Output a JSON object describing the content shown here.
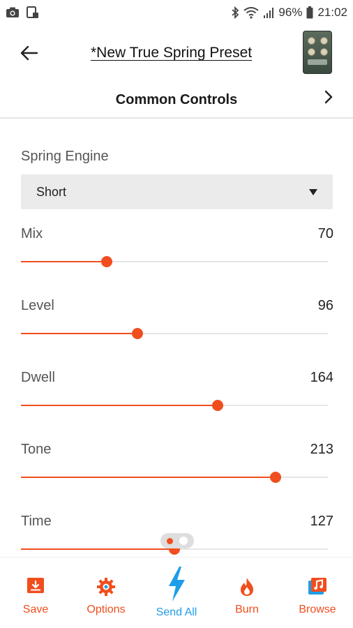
{
  "status_bar": {
    "battery": "96%",
    "time": "21:02",
    "icons": [
      "camera-icon",
      "image-sim-icon",
      "bluetooth-icon",
      "wifi-icon",
      "signal-icon",
      "battery-icon"
    ]
  },
  "header": {
    "preset_title": "*New True Spring Preset",
    "back_icon": "arrow-left-icon",
    "pedal_image": "true-spring-pedal-thumbnail"
  },
  "section": {
    "title": "Common Controls",
    "chevron_icon": "chevron-right-icon"
  },
  "spring_engine": {
    "label": "Spring Engine",
    "selected": "Short"
  },
  "parameters": [
    {
      "label": "Mix",
      "value": "70",
      "fraction": 0.28
    },
    {
      "label": "Level",
      "value": "96",
      "fraction": 0.38
    },
    {
      "label": "Dwell",
      "value": "164",
      "fraction": 0.64
    },
    {
      "label": "Tone",
      "value": "213",
      "fraction": 0.83
    },
    {
      "label": "Time",
      "value": "127",
      "fraction": 0.5
    }
  ],
  "bottom_nav": {
    "items": [
      {
        "label": "Save",
        "icon": "save-icon"
      },
      {
        "label": "Options",
        "icon": "gear-icon"
      },
      {
        "label": "Send All",
        "icon": "lightning-icon"
      },
      {
        "label": "Burn",
        "icon": "flame-icon"
      },
      {
        "label": "Browse",
        "icon": "music-library-icon"
      }
    ],
    "active": "Send All"
  },
  "colors": {
    "accent": "#f04e1e",
    "active_nav": "#1e9ee8",
    "select_bg": "#ebebeb"
  }
}
